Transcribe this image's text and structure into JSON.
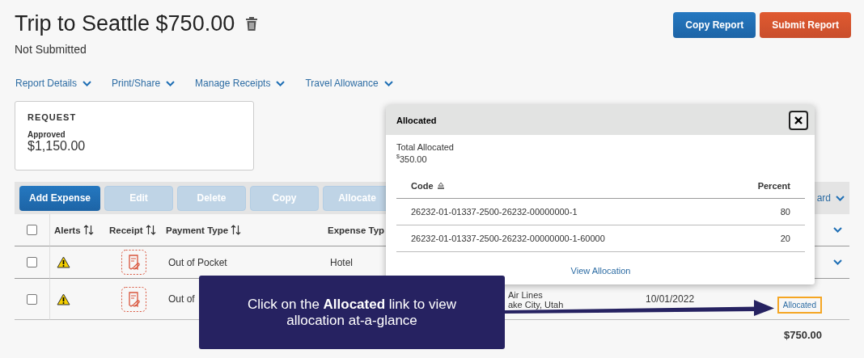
{
  "report": {
    "title": "Trip to Seattle $750.00",
    "status": "Not Submitted"
  },
  "actions": [
    {
      "label": "Copy Report",
      "kind": "secondary"
    },
    {
      "label": "Submit Report",
      "kind": "primary"
    }
  ],
  "nav": [
    {
      "label": "Report Details"
    },
    {
      "label": "Print/Share"
    },
    {
      "label": "Manage Receipts"
    },
    {
      "label": "Travel Allowance"
    }
  ],
  "request_card": {
    "heading": "REQUEST",
    "status": "Approved",
    "amount": "$1,150.00"
  },
  "toolbar": {
    "buttons": [
      {
        "label": "Add Expense",
        "disabled": false
      },
      {
        "label": "Edit",
        "disabled": true
      },
      {
        "label": "Delete",
        "disabled": true
      },
      {
        "label": "Copy",
        "disabled": true
      },
      {
        "label": "Allocate",
        "disabled": true
      }
    ],
    "view_menu": "ard"
  },
  "table": {
    "select_all_checked": false,
    "columns": [
      {
        "label": "Alerts",
        "sortable": true
      },
      {
        "label": "Receipt",
        "sortable": true
      },
      {
        "label": "Payment Type",
        "sortable": true
      },
      {
        "label": "Expense Typ",
        "sortable": false
      }
    ],
    "rows": [
      {
        "checked": false,
        "payment_type": "Out of Pocket",
        "expense_type": "Hotel",
        "expandable": true
      },
      {
        "checked": false,
        "payment_type": "Out of",
        "vendor": "Air Lines",
        "location": "ake City, Utah",
        "date": "10/01/2022",
        "allocation_link": "Allocated",
        "expandable": false
      }
    ],
    "total": "$750.00"
  },
  "popup": {
    "title": "Allocated",
    "total_label": "Total Allocated",
    "total_currency": "$",
    "total_amount": "350.00",
    "columns": [
      "Code",
      "Percent"
    ],
    "rows": [
      {
        "code": "26232-01-01337-2500-26232-00000000-1",
        "percent": "80"
      },
      {
        "code": "26232-01-01337-2500-26232-00000000-1-60000",
        "percent": "20"
      }
    ],
    "link": "View Allocation"
  },
  "callout": {
    "text": "Click on the **Allocated** link to view allocation at-a-glance"
  }
}
